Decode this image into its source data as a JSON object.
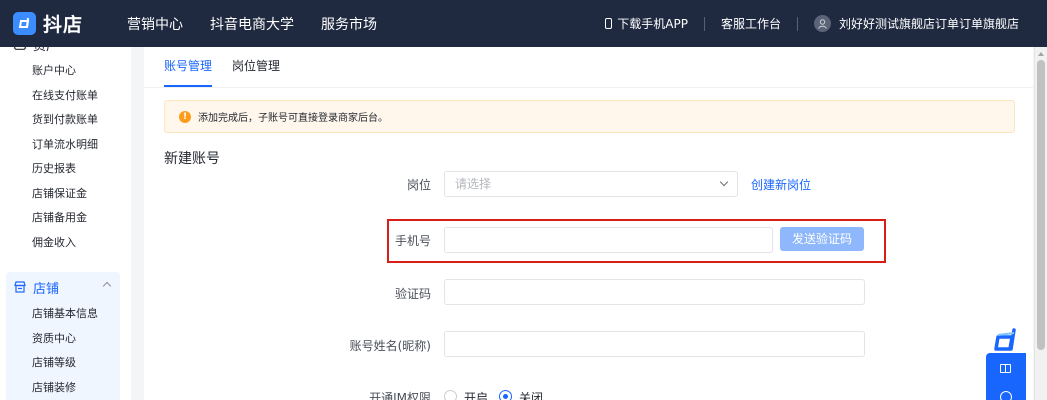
{
  "topbar": {
    "logo_text": "抖店",
    "nav": [
      "营销中心",
      "抖音电商大学",
      "服务市场"
    ],
    "download_app": "下载手机APP",
    "service": "客服工作台",
    "shop_name": "刘好好测试旗舰店订单订单旗舰店"
  },
  "sidebar": {
    "asset_group": {
      "title": "资产",
      "items": [
        "账户中心",
        "在线支付账单",
        "货到付款账单",
        "订单流水明细",
        "历史报表",
        "店铺保证金",
        "店铺备用金",
        "佣金收入"
      ]
    },
    "shop_group": {
      "title": "店铺",
      "items": [
        "店铺基本信息",
        "资质中心",
        "店铺等级",
        "店铺装修"
      ]
    }
  },
  "tabs": [
    "账号管理",
    "岗位管理"
  ],
  "alert": "添加完成后，子账号可直接登录商家后台。",
  "section_title": "新建账号",
  "form": {
    "position_label": "岗位",
    "position_placeholder": "请选择",
    "create_position": "创建新岗位",
    "phone_label": "手机号",
    "send_code": "发送验证码",
    "code_label": "验证码",
    "name_label": "账号姓名(昵称)",
    "im_label": "开通IM权限",
    "im_on": "开启",
    "im_off": "关闭"
  },
  "colors": {
    "topbar": "#1f2940",
    "accent": "#1966ff",
    "highlight": "#d91e18"
  }
}
